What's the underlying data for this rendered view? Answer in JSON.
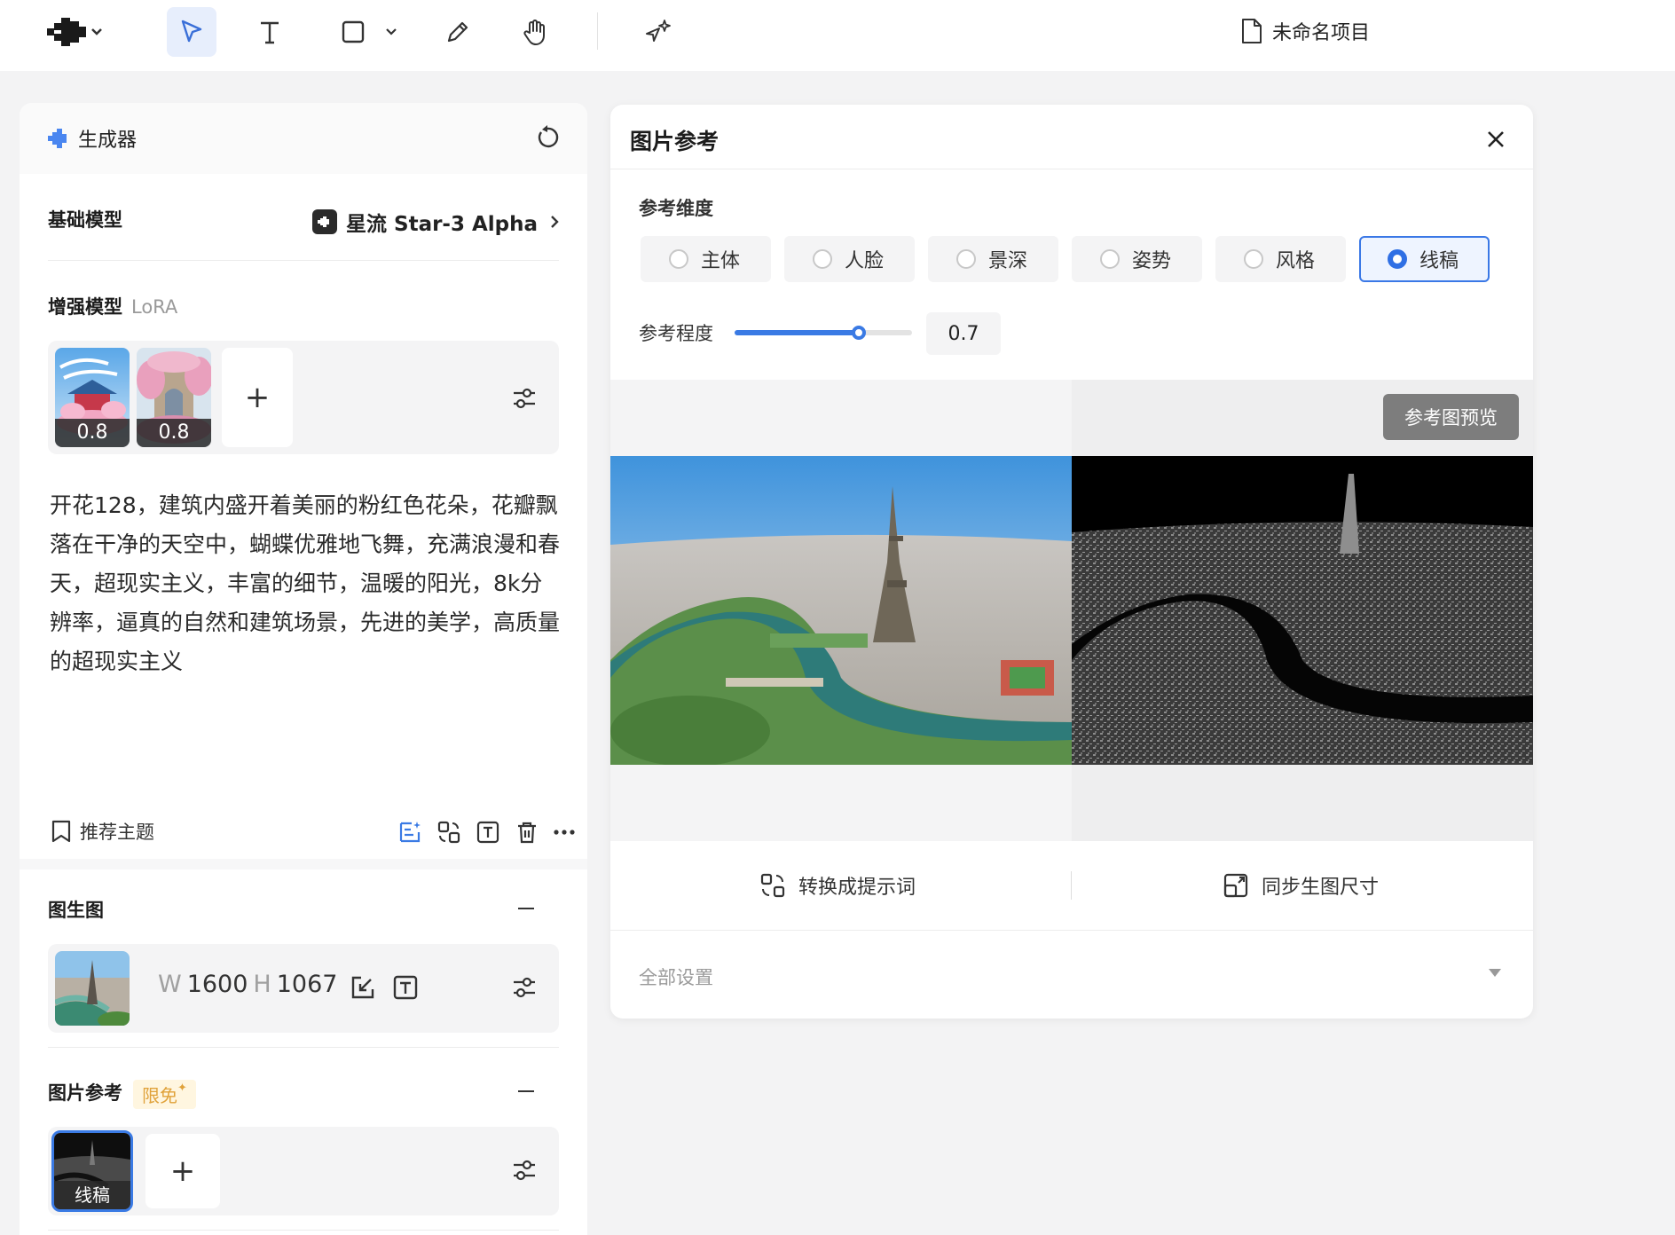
{
  "project": {
    "name": "未命名项目"
  },
  "generator": {
    "title": "生成器",
    "base_model": {
      "label": "基础模型",
      "value": "星流 Star-3 Alpha"
    },
    "lora": {
      "label": "增强模型",
      "sub": "LoRA",
      "items": [
        {
          "weight": "0.8"
        },
        {
          "weight": "0.8"
        }
      ],
      "add": "+"
    },
    "prompt": "开花128，建筑内盛开着美丽的粉红色花朵，花瓣飘落在干净的天空中，蝴蝶优雅地飞舞，充满浪漫和春天，超现实主义，丰富的细节，温暖的阳光，8k分辨率，逼真的自然和建筑场景，先进的美学，高质量的超现实主义",
    "theme_button": "推荐主题",
    "img2img": {
      "label": "图生图",
      "w_key": "W",
      "w": "1600",
      "h_key": "H",
      "h": "1067"
    },
    "image_ref": {
      "label": "图片参考",
      "badge": "限免",
      "item_caption": "线稿",
      "add": "+"
    }
  },
  "ref_panel": {
    "title": "图片参考",
    "dimension_label": "参考维度",
    "dimensions": [
      "主体",
      "人脸",
      "景深",
      "姿势",
      "风格",
      "线稿"
    ],
    "selected_dimension": "线稿",
    "degree_label": "参考程度",
    "degree_value": "0.7",
    "degree_fraction": 0.7,
    "preview_button": "参考图预览",
    "to_prompt": "转换成提示词",
    "sync_size": "同步生图尺寸",
    "all_settings": "全部设置"
  },
  "colors": {
    "accent": "#3a7ae4",
    "badge_text": "#e0a23a",
    "badge_bg": "#fff6e0"
  }
}
